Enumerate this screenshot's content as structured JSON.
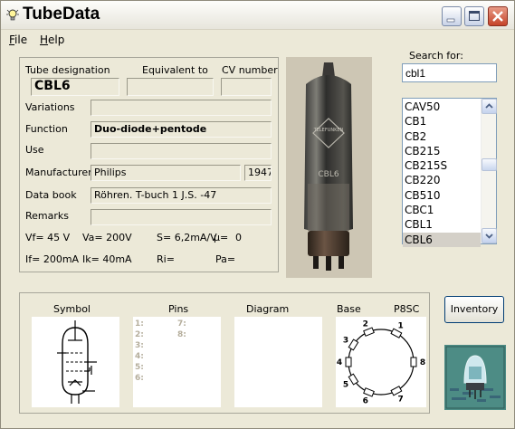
{
  "window": {
    "title": "TubeData",
    "minimize_icon": "minimize-icon",
    "maximize_icon": "maximize-icon",
    "close_icon": "close-icon",
    "app_icon": "lightbulb-icon"
  },
  "menu": {
    "file": {
      "first": "F",
      "rest": "ile"
    },
    "help": {
      "first": "H",
      "rest": "elp"
    }
  },
  "details": {
    "tube_designation_label": "Tube designation",
    "equivalent_label": "Equivalent to",
    "cv_label": "CV number",
    "tube_designation": "CBL6",
    "equivalent": "",
    "cv_number": "",
    "variations_label": "Variations",
    "variations": "",
    "function_label": "Function",
    "function": "Duo-diode+pentode",
    "use_label": "Use",
    "use": "",
    "manufacturer_label": "Manufacturer",
    "manufacturer": "Philips",
    "year": "1947",
    "databook_label": "Data book",
    "databook": "Röhren. T-buch 1 J.S. -47",
    "remarks_label": "Remarks",
    "remarks": ""
  },
  "parameters": {
    "vf": "Vf= 45 V",
    "va": "Va= 200V",
    "s": "S= 6,2mA/V",
    "mu": "μ=",
    "mu_value": "0",
    "if": "If= 200mA",
    "ik": "Ik= 40mA",
    "ri": "Ri=",
    "pa": "Pa="
  },
  "search": {
    "label": "Search for:",
    "value": "cbl1",
    "results": [
      "CAV50",
      "CB1",
      "CB2",
      "CB215",
      "CB215S",
      "CB220",
      "CB510",
      "CBC1",
      "CBL1",
      "CBL6"
    ],
    "selected": "CBL6"
  },
  "photo": {
    "brand": "TELEFUNKEN",
    "tube_label": "CBL6"
  },
  "bottom": {
    "symbol_label": "Symbol",
    "pins_label": "Pins",
    "diagram_label": "Diagram",
    "base_label": "Base",
    "base_type": "P8SC",
    "pins_left": [
      "1:",
      "2:",
      "3:",
      "4:",
      "5:",
      "6:"
    ],
    "pins_right": [
      "7:",
      "8:"
    ],
    "base_pin_numbers": [
      "1",
      "2",
      "3",
      "4",
      "5",
      "6",
      "7",
      "8"
    ]
  },
  "inventory_button": "Inventory",
  "colors": {
    "window_bg": "#ece9d8",
    "field_border": "#9a9889",
    "input_border": "#7f9db9",
    "close_red": "#c5432a",
    "selected_row": "#d4d0c8"
  }
}
